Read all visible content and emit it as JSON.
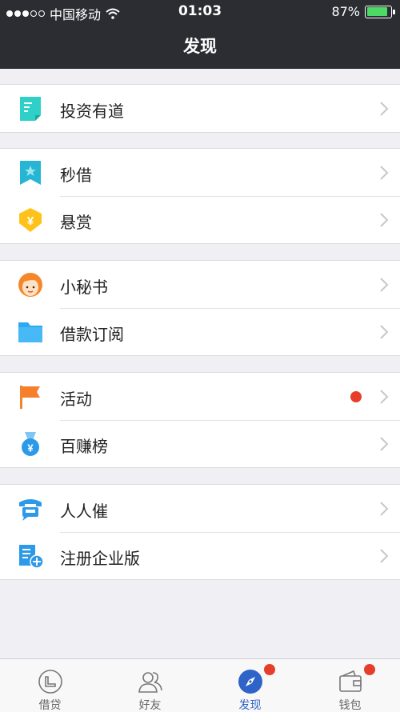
{
  "status_bar": {
    "carrier": "中国移动",
    "time": "01:03",
    "battery": "87%",
    "battery_level": 0.87
  },
  "nav": {
    "title": "发现"
  },
  "groups": [
    {
      "items": [
        {
          "label": "投资有道",
          "icon": "document-icon"
        }
      ]
    },
    {
      "items": [
        {
          "label": "秒借",
          "icon": "bookmark-star-icon"
        },
        {
          "label": "悬赏",
          "icon": "yen-shield-icon"
        }
      ]
    },
    {
      "items": [
        {
          "label": "小秘书",
          "icon": "secretary-avatar-icon"
        },
        {
          "label": "借款订阅",
          "icon": "folder-icon"
        }
      ]
    },
    {
      "items": [
        {
          "label": "活动",
          "icon": "flag-icon",
          "has_dot": true
        },
        {
          "label": "百赚榜",
          "icon": "yen-medal-icon"
        }
      ]
    },
    {
      "items": [
        {
          "label": "人人催",
          "icon": "telephone-icon"
        },
        {
          "label": "注册企业版",
          "icon": "enterprise-add-icon"
        }
      ]
    }
  ],
  "tabbar": {
    "tabs": [
      {
        "label": "借贷",
        "icon": "loan-icon",
        "active": false
      },
      {
        "label": "好友",
        "icon": "friends-icon",
        "active": false
      },
      {
        "label": "发现",
        "icon": "compass-icon",
        "active": true,
        "badge": true
      },
      {
        "label": "钱包",
        "icon": "wallet-icon",
        "active": false,
        "badge": true
      }
    ]
  },
  "colors": {
    "accent": "#2e63c7",
    "badge": "#e63e2a",
    "navbar": "#2b2d33"
  }
}
